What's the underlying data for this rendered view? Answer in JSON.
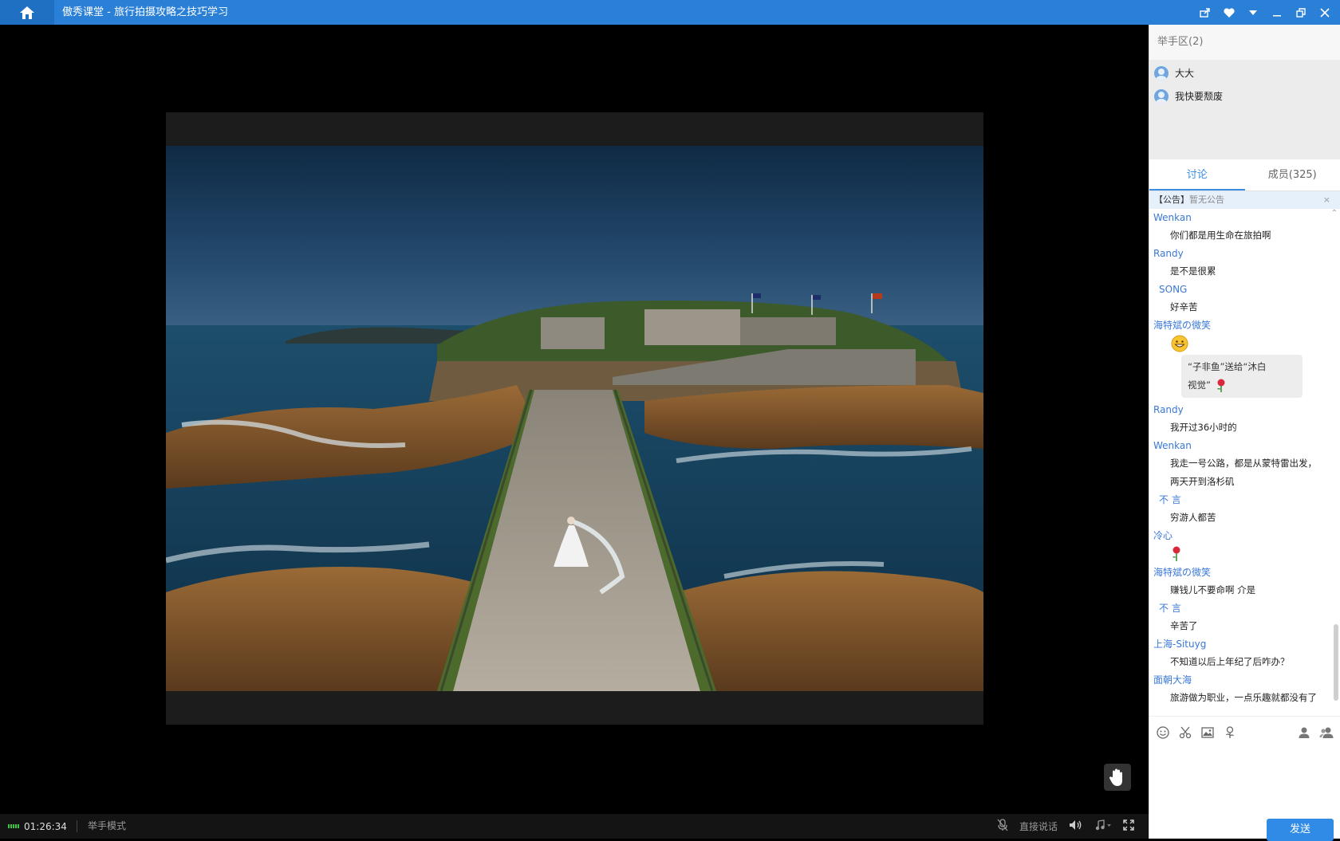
{
  "window": {
    "title": "傲秀课堂 - 旅行拍摄攻略之技巧学习"
  },
  "raise_hand": {
    "header": "举手区(2)",
    "users": [
      "大大",
      "我快要颓废"
    ]
  },
  "tabs": [
    {
      "label": "讨论",
      "active": true
    },
    {
      "label": "成员(325)",
      "active": false
    }
  ],
  "notice": {
    "tag": "【公告】",
    "text": "暂无公告",
    "close": "×"
  },
  "chat": {
    "messages": [
      {
        "user": "Wenkan",
        "lines": [
          "你们都是用生命在旅拍啊"
        ]
      },
      {
        "user": "Randy",
        "lines": [
          "是不是很累"
        ]
      },
      {
        "user": "SONG",
        "lines": [
          "好辛苦"
        ]
      },
      {
        "user": "海特斌の微笑",
        "emoji": "grin"
      },
      {
        "gift": [
          "“子非鱼”送给“沐白",
          "视觉”"
        ]
      },
      {
        "user": "Randy",
        "lines": [
          "我开过36小时的"
        ]
      },
      {
        "user": "Wenkan",
        "lines": [
          "我走一号公路，都是从蒙特雷出发，",
          "两天开到洛杉矶"
        ]
      },
      {
        "user": "不 言",
        "lines": [
          "穷游人都苦"
        ]
      },
      {
        "user": "冷心",
        "emoji": "rose"
      },
      {
        "user": "海特斌の微笑",
        "lines": [
          "赚钱儿不要命啊 介是"
        ]
      },
      {
        "user": "不 言",
        "lines": [
          "辛苦了"
        ]
      },
      {
        "user": "上海-Situyg",
        "lines": [
          "不知道以后上年纪了后咋办？"
        ]
      },
      {
        "user": "面朝大海",
        "lines": [
          "旅游做为职业，一点乐趣就都没有了"
        ]
      }
    ]
  },
  "send_label": "发送",
  "bottom": {
    "time": "01:26:34",
    "mode": "举手模式",
    "speak": "直接说话"
  },
  "colors": {
    "titlebar": "#2a7fd6",
    "accent": "#3a8ee6",
    "username": "#3a78d6"
  }
}
